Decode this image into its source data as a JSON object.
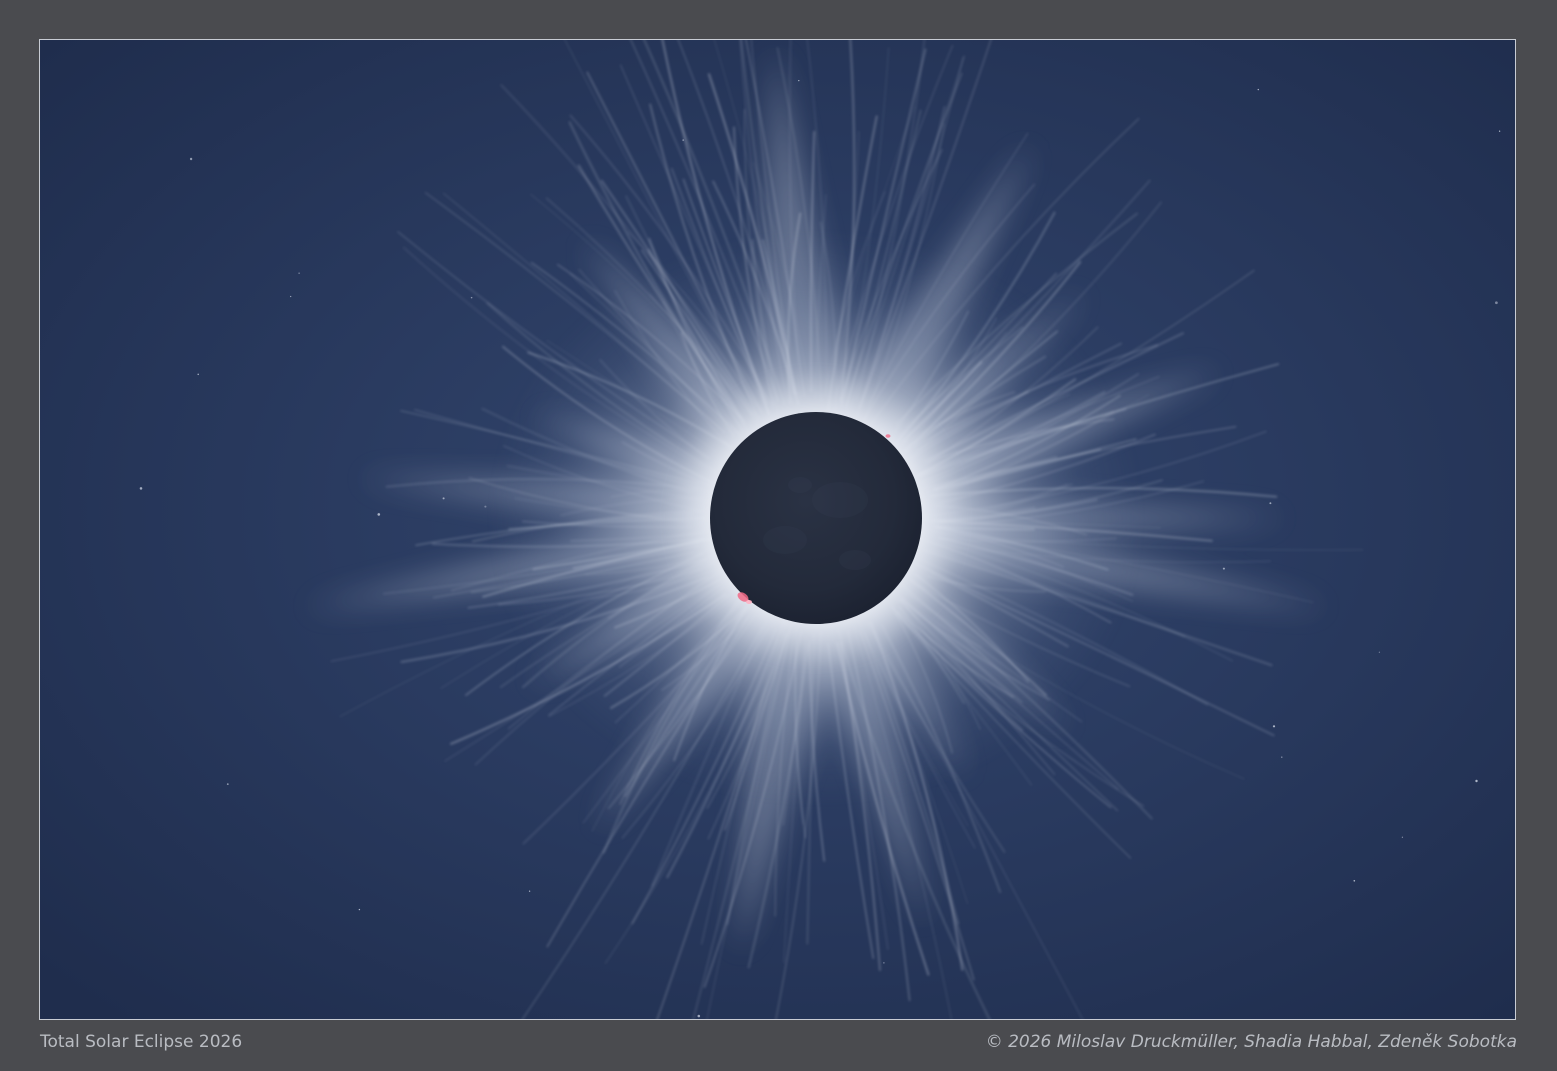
{
  "photo": {
    "subject": "eclipse-photo",
    "colors": {
      "sky": "#243456",
      "sky_light": "#2f4168",
      "corona": "#eef1f6",
      "moon": "#232a3a",
      "prominence": "#f06a86",
      "frame": "#4a4b4f",
      "caption_text": "#b9bcc2"
    }
  },
  "caption": {
    "title": "Total Solar Eclipse 2026",
    "credit": "© 2026 Miloslav Druckmüller, Shadia Habbal, Zdeněk Sobotka"
  }
}
